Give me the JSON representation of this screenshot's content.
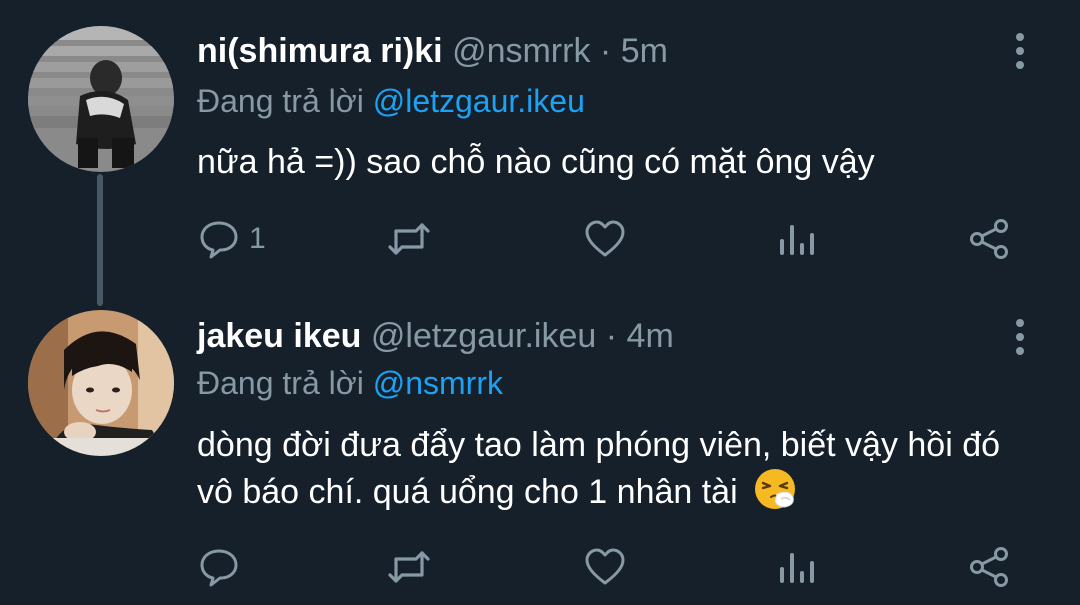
{
  "tweets": [
    {
      "author_name": "ni(shimura ri)ki",
      "author_handle": "@nsmrrk",
      "separator": "·",
      "time": "5m",
      "replying_prefix": "Đang trả lời",
      "replying_to": "@letzgaur.ikeu",
      "text": "nữa hả =)) sao chỗ nào cũng có mặt ông vậy",
      "reply_count": "1"
    },
    {
      "author_name": "jakeu ikeu",
      "author_handle": "@letzgaur.ikeu",
      "separator": "·",
      "time": "4m",
      "replying_prefix": "Đang trả lời",
      "replying_to": "@nsmrrk",
      "text": "dòng đời đưa đẩy tao làm phóng viên, biết vậy hồi đó vô báo chí. quá uổng cho 1 nhân tài",
      "emoji": "sneezing-face-emoji",
      "reply_count": ""
    }
  ],
  "colors": {
    "background": "#15202b",
    "primary_text": "#ffffff",
    "secondary_text": "#8899a6",
    "link": "#1da1f2"
  },
  "icons": [
    "reply-icon",
    "retweet-icon",
    "like-icon",
    "analytics-icon",
    "share-icon",
    "more-options-icon"
  ]
}
